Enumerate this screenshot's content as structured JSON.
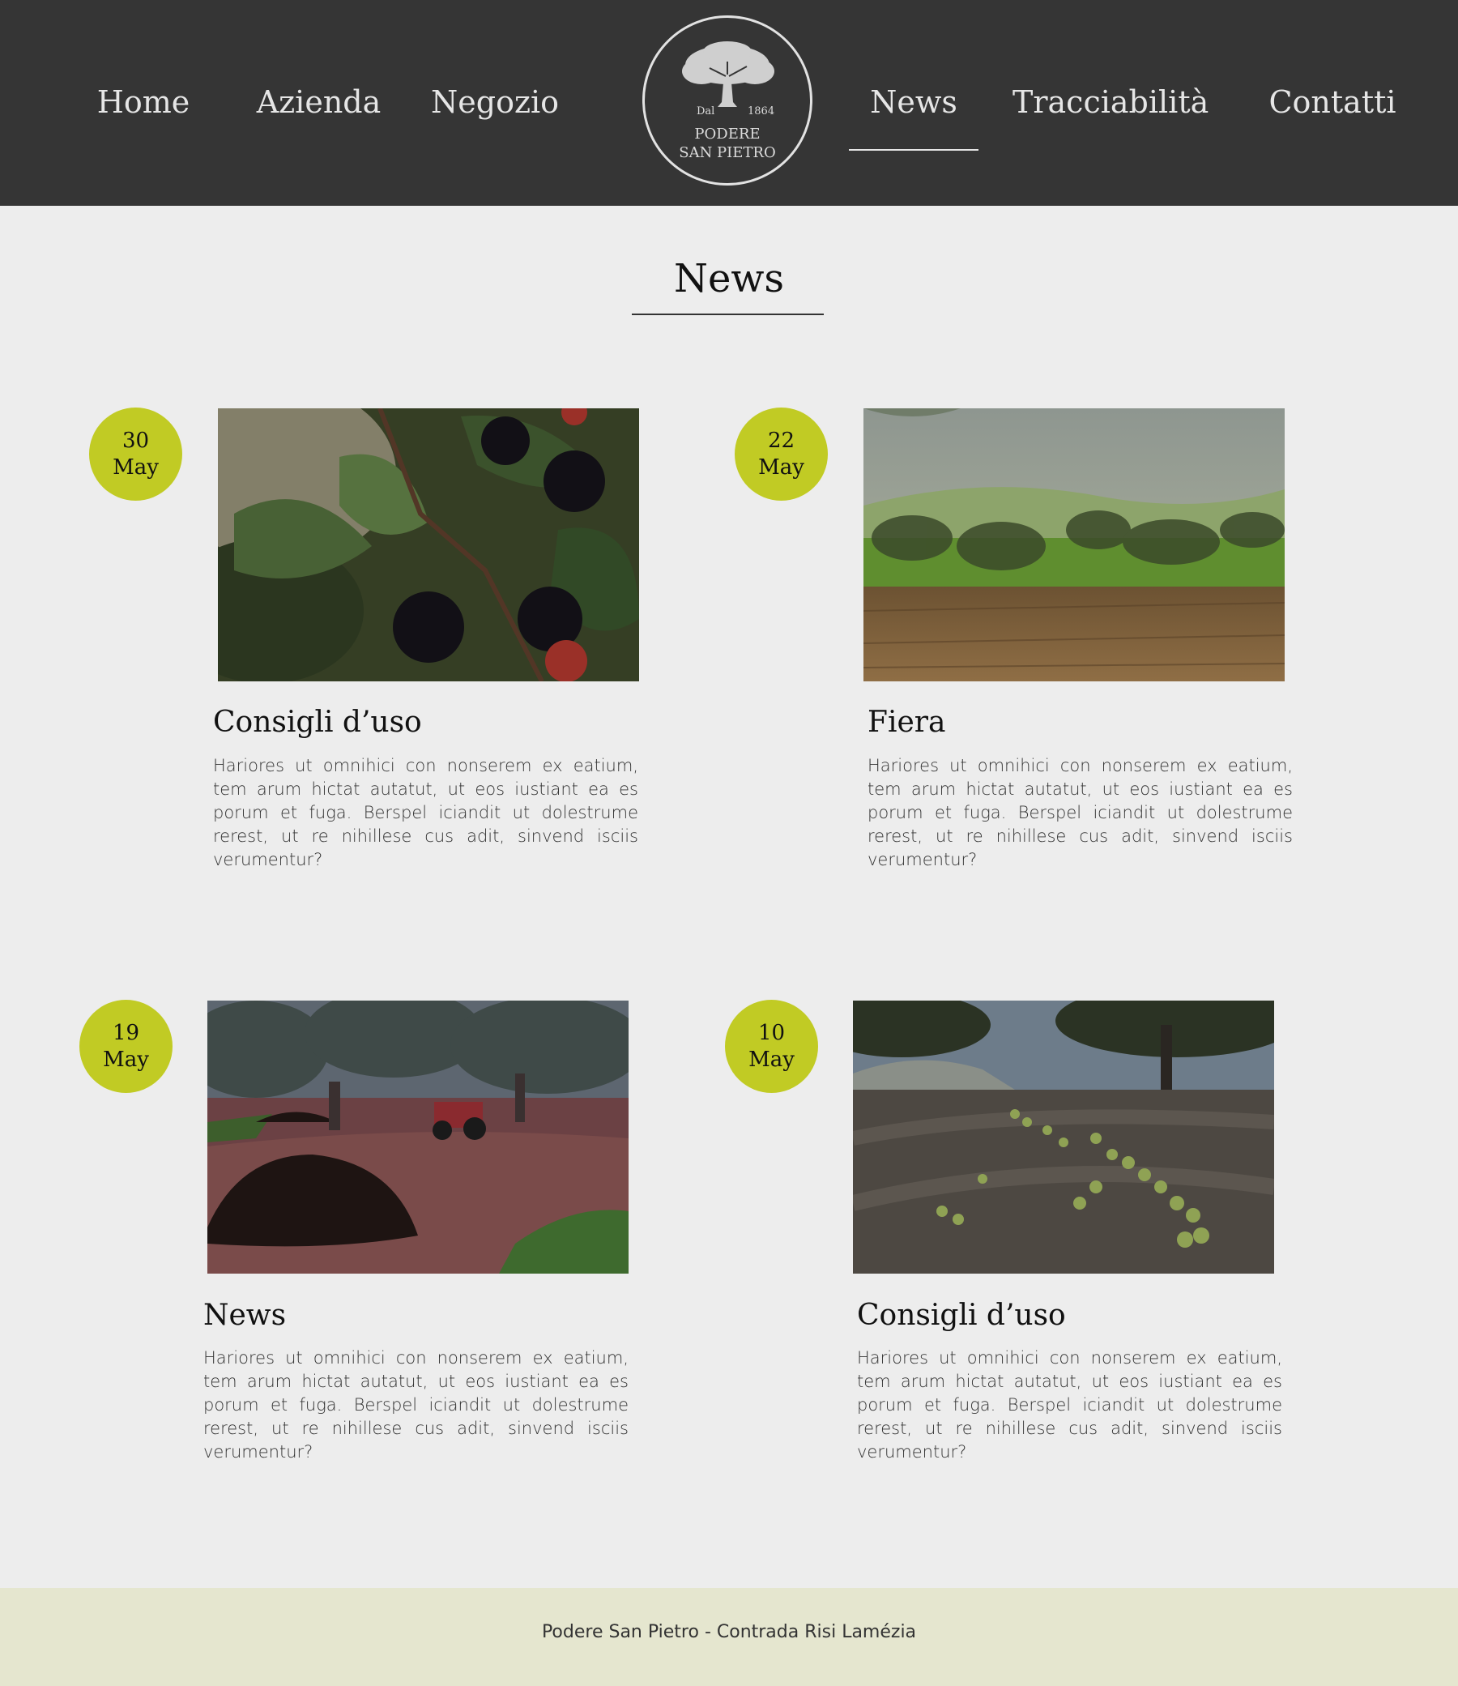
{
  "nav": {
    "left": [
      {
        "label": "Home"
      },
      {
        "label": "Azienda"
      },
      {
        "label": "Negozio"
      }
    ],
    "right": [
      {
        "label": "News",
        "active": true
      },
      {
        "label": "Tracciabilità"
      },
      {
        "label": "Contatti"
      }
    ]
  },
  "logo": {
    "icon": "olive-tree-icon",
    "dal": "Dal",
    "year": "1864",
    "name_line1": "PODERE",
    "name_line2": "SAN PIETRO"
  },
  "page": {
    "title": "News"
  },
  "posts": [
    {
      "day": "30",
      "month": "May",
      "title": "Consigli d’uso",
      "body": "Hariores ut omnihici con nonserem ex eatium, tem arum hictat autatut, ut eos iustiant ea es porum et fuga. Berspel iciandit ut dolestrume rerest, ut re nihillese cus adit, sinvend isciis verumentur?",
      "image": "blackberries-photo"
    },
    {
      "day": "22",
      "month": "May",
      "title": "Fiera",
      "body": "Hariores ut omnihici con nonserem ex eatium, tem arum hictat autatut, ut eos iustiant ea es porum et fuga. Berspel iciandit ut dolestrume rerest, ut re nihillese cus adit, sinvend isciis verumentur?",
      "image": "wooden-table-landscape-photo"
    },
    {
      "day": "19",
      "month": "May",
      "title": "News",
      "body": "Hariores ut omnihici con nonserem ex eatium, tem arum hictat autatut, ut eos iustiant ea es porum et fuga. Berspel iciandit ut dolestrume rerest, ut re nihillese cus adit, sinvend isciis verumentur?",
      "image": "olive-grove-tractor-photo"
    },
    {
      "day": "10",
      "month": "May",
      "title": "Consigli d’uso",
      "body": "Hariores ut omnihici con nonserem ex eatium, tem arum hictat autatut, ut eos iustiant ea es porum et fuga. Berspel iciandit ut dolestrume rerest, ut re nihillese cus adit, sinvend isciis verumentur?",
      "image": "olive-harvest-nets-photo"
    }
  ],
  "footer": {
    "text": "Podere San Pietro - Contrada Risi Lamézia"
  },
  "colors": {
    "header_bg": "#353535",
    "page_bg": "#ededed",
    "accent": "#c1cb24",
    "footer_bg": "#e5e6cf"
  }
}
